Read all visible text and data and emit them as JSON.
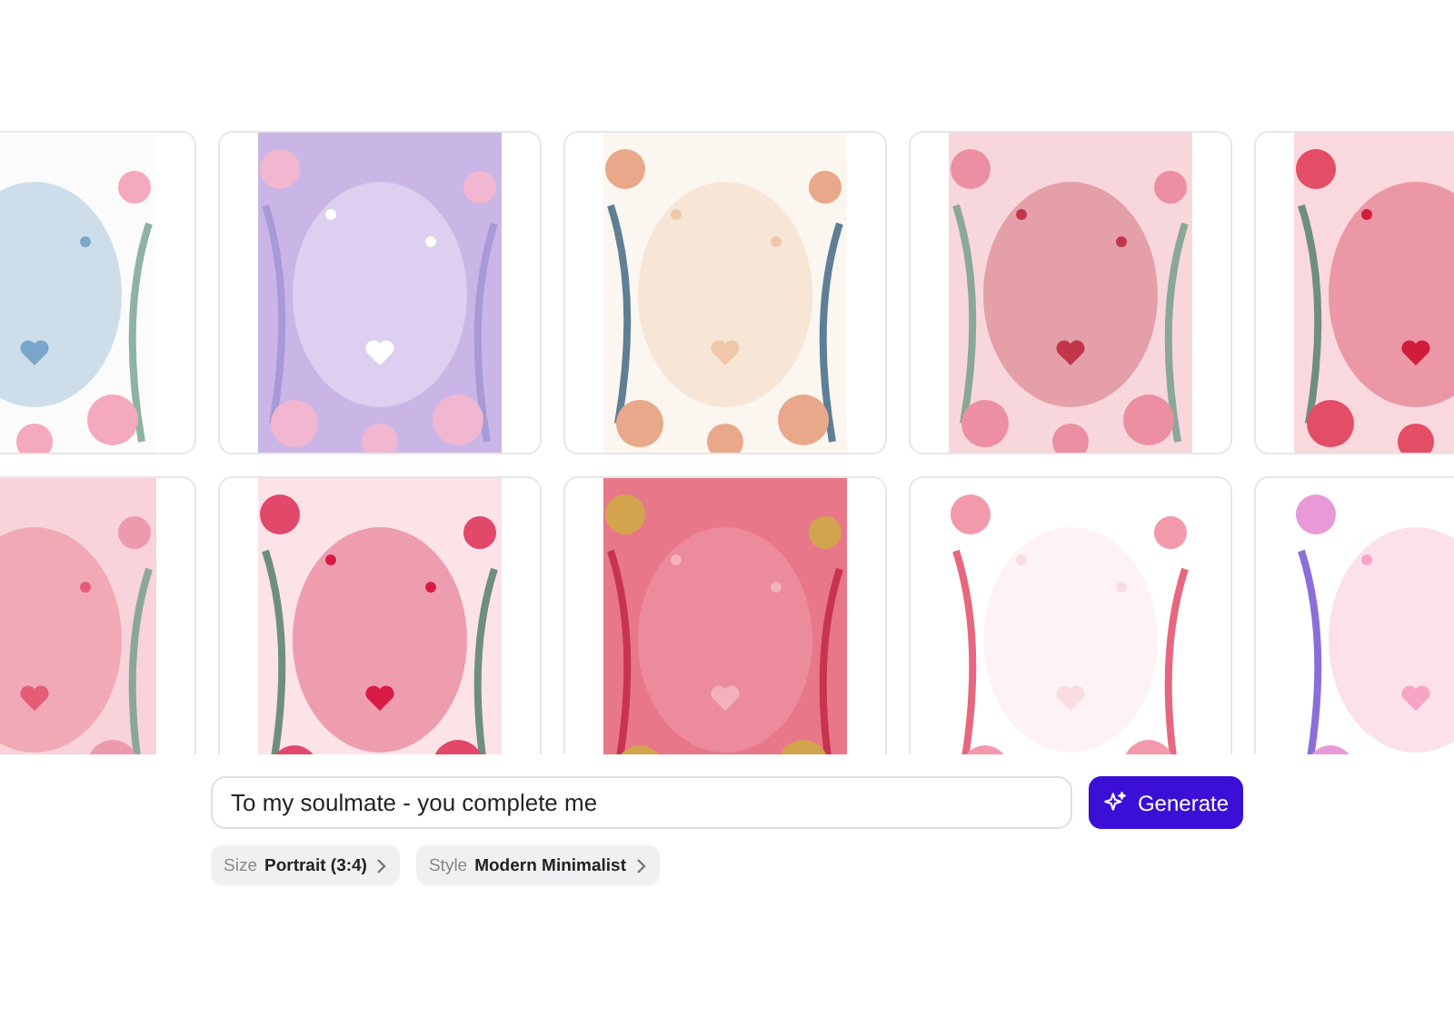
{
  "prompt": {
    "value": "To my soulmate - you complete me"
  },
  "generate_button": {
    "label": "Generate"
  },
  "options": [
    {
      "label": "Size",
      "value": "Portrait (3:4)"
    },
    {
      "label": "Style",
      "value": "Modern Minimalist"
    }
  ]
}
